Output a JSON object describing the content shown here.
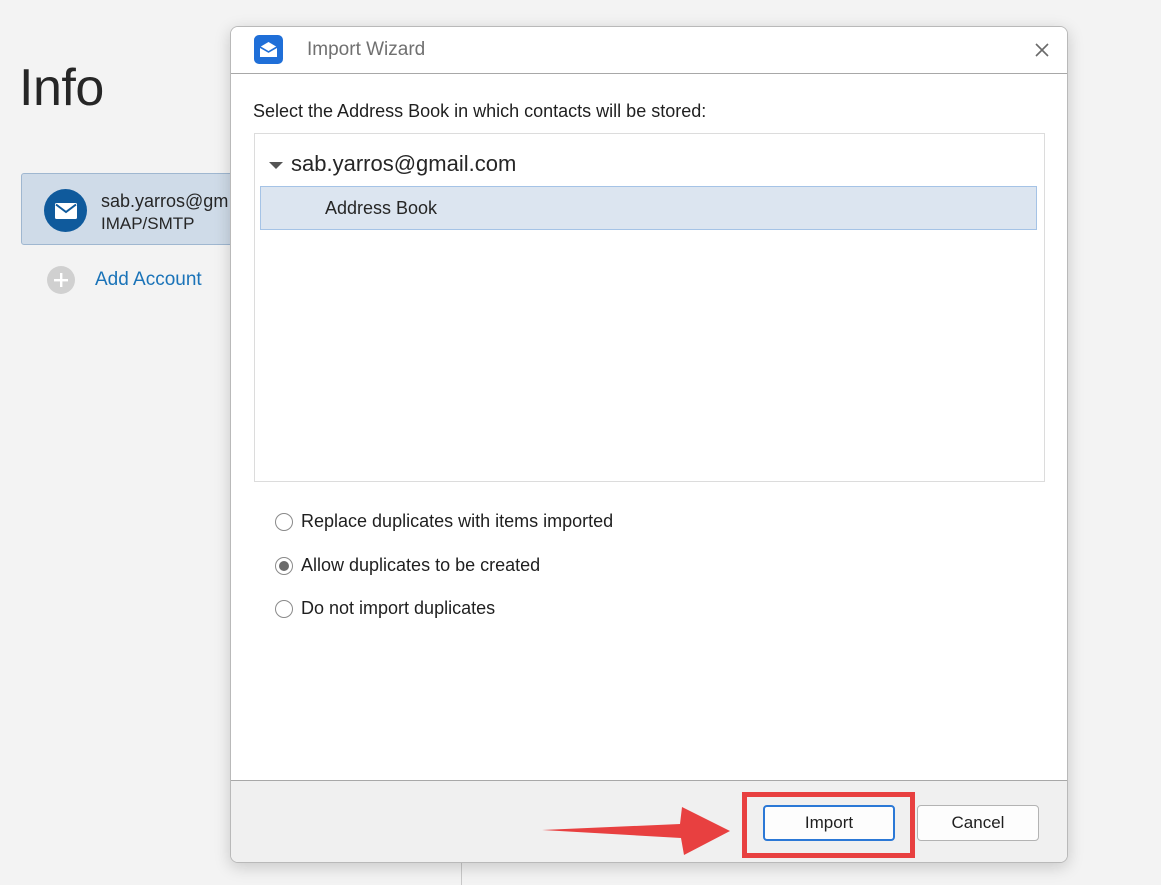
{
  "background": {
    "page_title": "Info",
    "account": {
      "email": "sab.yarros@gm",
      "type": "IMAP/SMTP",
      "icon": "mail-icon"
    },
    "add_account_label": "Add Account"
  },
  "dialog": {
    "title": "Import Wizard",
    "prompt": "Select the Address Book in which contacts will be stored:",
    "tree": {
      "root_label": "sab.yarros@gmail.com",
      "selected_item": "Address Book"
    },
    "options": [
      {
        "label": "Replace duplicates with items imported",
        "selected": false
      },
      {
        "label": "Allow duplicates to be created",
        "selected": true
      },
      {
        "label": "Do not import duplicates",
        "selected": false
      }
    ],
    "buttons": {
      "import_label": "Import",
      "cancel_label": "Cancel"
    }
  },
  "annotation": {
    "highlight_color": "#e84040",
    "arrow_color": "#e84040"
  }
}
